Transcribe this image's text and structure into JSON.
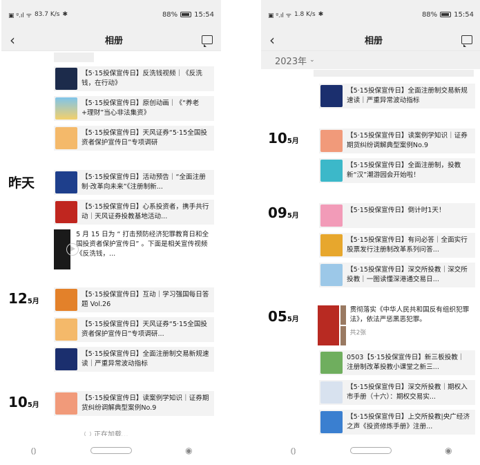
{
  "colors": {
    "accent": "#f5a623",
    "header_bg": "#f0f0f0",
    "item_bg": "#f3f3f3"
  },
  "left": {
    "status": {
      "signal": "83.7 K/s",
      "battery": "88%",
      "time": "15:54"
    },
    "header": {
      "title": "相册"
    },
    "items_top": [
      {
        "text": "【5·15投保宣传日】反洗钱视频｜《反洗钱，在行动》",
        "icon": "video-thumb",
        "color": "#1c2b4b"
      },
      {
        "text": "【5·15投保宣传日】原创动画｜《“养老+理财”当心非法集资》",
        "icon": "cartoon-thumb",
        "color": "#5aa7d6"
      },
      {
        "text": "【5·15投保宣传日】天风证券“5·15全国投资者保护宣传日”专项调研",
        "icon": "document-thumb",
        "color": "#f4b96a"
      }
    ],
    "yesterday": {
      "label": "昨天",
      "items": [
        {
          "text": "【5·15投保宣传日】活动预告｜“全面注册制·改革向未来”《注册制新...",
          "icon": "event-thumb",
          "color": "#1e3f8c"
        },
        {
          "text": "【5·15投保宣传日】心系投资者，携手共行动｜天风证券投教基地活动...",
          "icon": "red-poster-thumb",
          "color": "#c0261f"
        }
      ],
      "video": {
        "text": "5 月 15 日为 “ 打击预防经济犯罪教育日和全国投资者保护宣传日” 。下面是相关宣传视频《反洗钱，..."
      }
    },
    "day12": {
      "day": "12",
      "month": "5月",
      "items": [
        {
          "text": "【5·15投保宣传日】互动｜学习强国每日答题 Vol.26",
          "icon": "quiz-thumb",
          "color": "#e3812a"
        },
        {
          "text": "【5·15投保宣传日】天风证券“5·15全国投资者保护宣传日”专项调研...",
          "icon": "document-thumb",
          "color": "#f4b96a"
        },
        {
          "text": "【5·15投保宣传日】全面注册制交易新规速读｜严重异常波动指标",
          "icon": "rules-thumb",
          "color": "#1b2f6e"
        }
      ]
    },
    "day10": {
      "day": "10",
      "month": "5月",
      "items": [
        {
          "text": "【5·15投保宣传日】读案例学知识｜证券期货纠纷调解典型案例No.9",
          "icon": "lantern-thumb",
          "color": "#f19a7a"
        }
      ]
    },
    "loading": "正在加载..."
  },
  "right": {
    "status": {
      "signal": "1.8 K/s",
      "battery": "88%",
      "time": "15:54"
    },
    "header": {
      "title": "相册"
    },
    "year": "2023年",
    "items_top": [
      {
        "text": "【5·15投保宣传日】全面注册制交易新规速读｜严重异常波动指标",
        "icon": "rules-thumb",
        "color": "#1b2f6e"
      }
    ],
    "day10": {
      "day": "10",
      "month": "5月",
      "items": [
        {
          "text": "【5·15投保宣传日】读案例学知识｜证券期货纠纷调解典型案例No.9",
          "icon": "lantern-thumb",
          "color": "#f19a7a"
        },
        {
          "text": "【5·15投保宣传日】全面注册制，投教新“汉”潮游园会开始啦！",
          "icon": "fair-thumb",
          "color": "#3cb8c9"
        }
      ]
    },
    "day09": {
      "day": "09",
      "month": "5月",
      "items": [
        {
          "text": "【5·15投保宣传日】倒计时1天！",
          "icon": "countdown-thumb",
          "color": "#f29bb8"
        },
        {
          "text": "【5·15投保宣传日】有问必答｜全面实行股票发行注册制改革系列问答...",
          "icon": "qa-thumb",
          "color": "#e7a72d"
        },
        {
          "text": "【5·15投保宣传日】深交所投教｜深交所投教｜一图读懂深港通交易日...",
          "icon": "infographic-thumb",
          "color": "#9cc8e8"
        }
      ]
    },
    "day05": {
      "day": "05",
      "month": "5月",
      "album": {
        "text": "贯彻落实《中华人民共和国反有组织犯罪法》，依法严惩黑恶犯罪。",
        "count": "共2张"
      },
      "items": [
        {
          "text": "0503【5·15投保宣传日】新三板投教｜注册制改革投教小课堂之新三...",
          "icon": "class-thumb",
          "color": "#6fae5e"
        },
        {
          "text": "【5·15投保宣传日】深交所投教｜期权入市手册（十六）：期权交易实...",
          "icon": "manual-thumb",
          "color": "#d8e2ef"
        },
        {
          "text": "【5·15投保宣传日】上交所投教|央广经济之声《投资修炼手册》注册...",
          "icon": "broadcast-thumb",
          "color": "#3a7fd0"
        }
      ]
    }
  }
}
